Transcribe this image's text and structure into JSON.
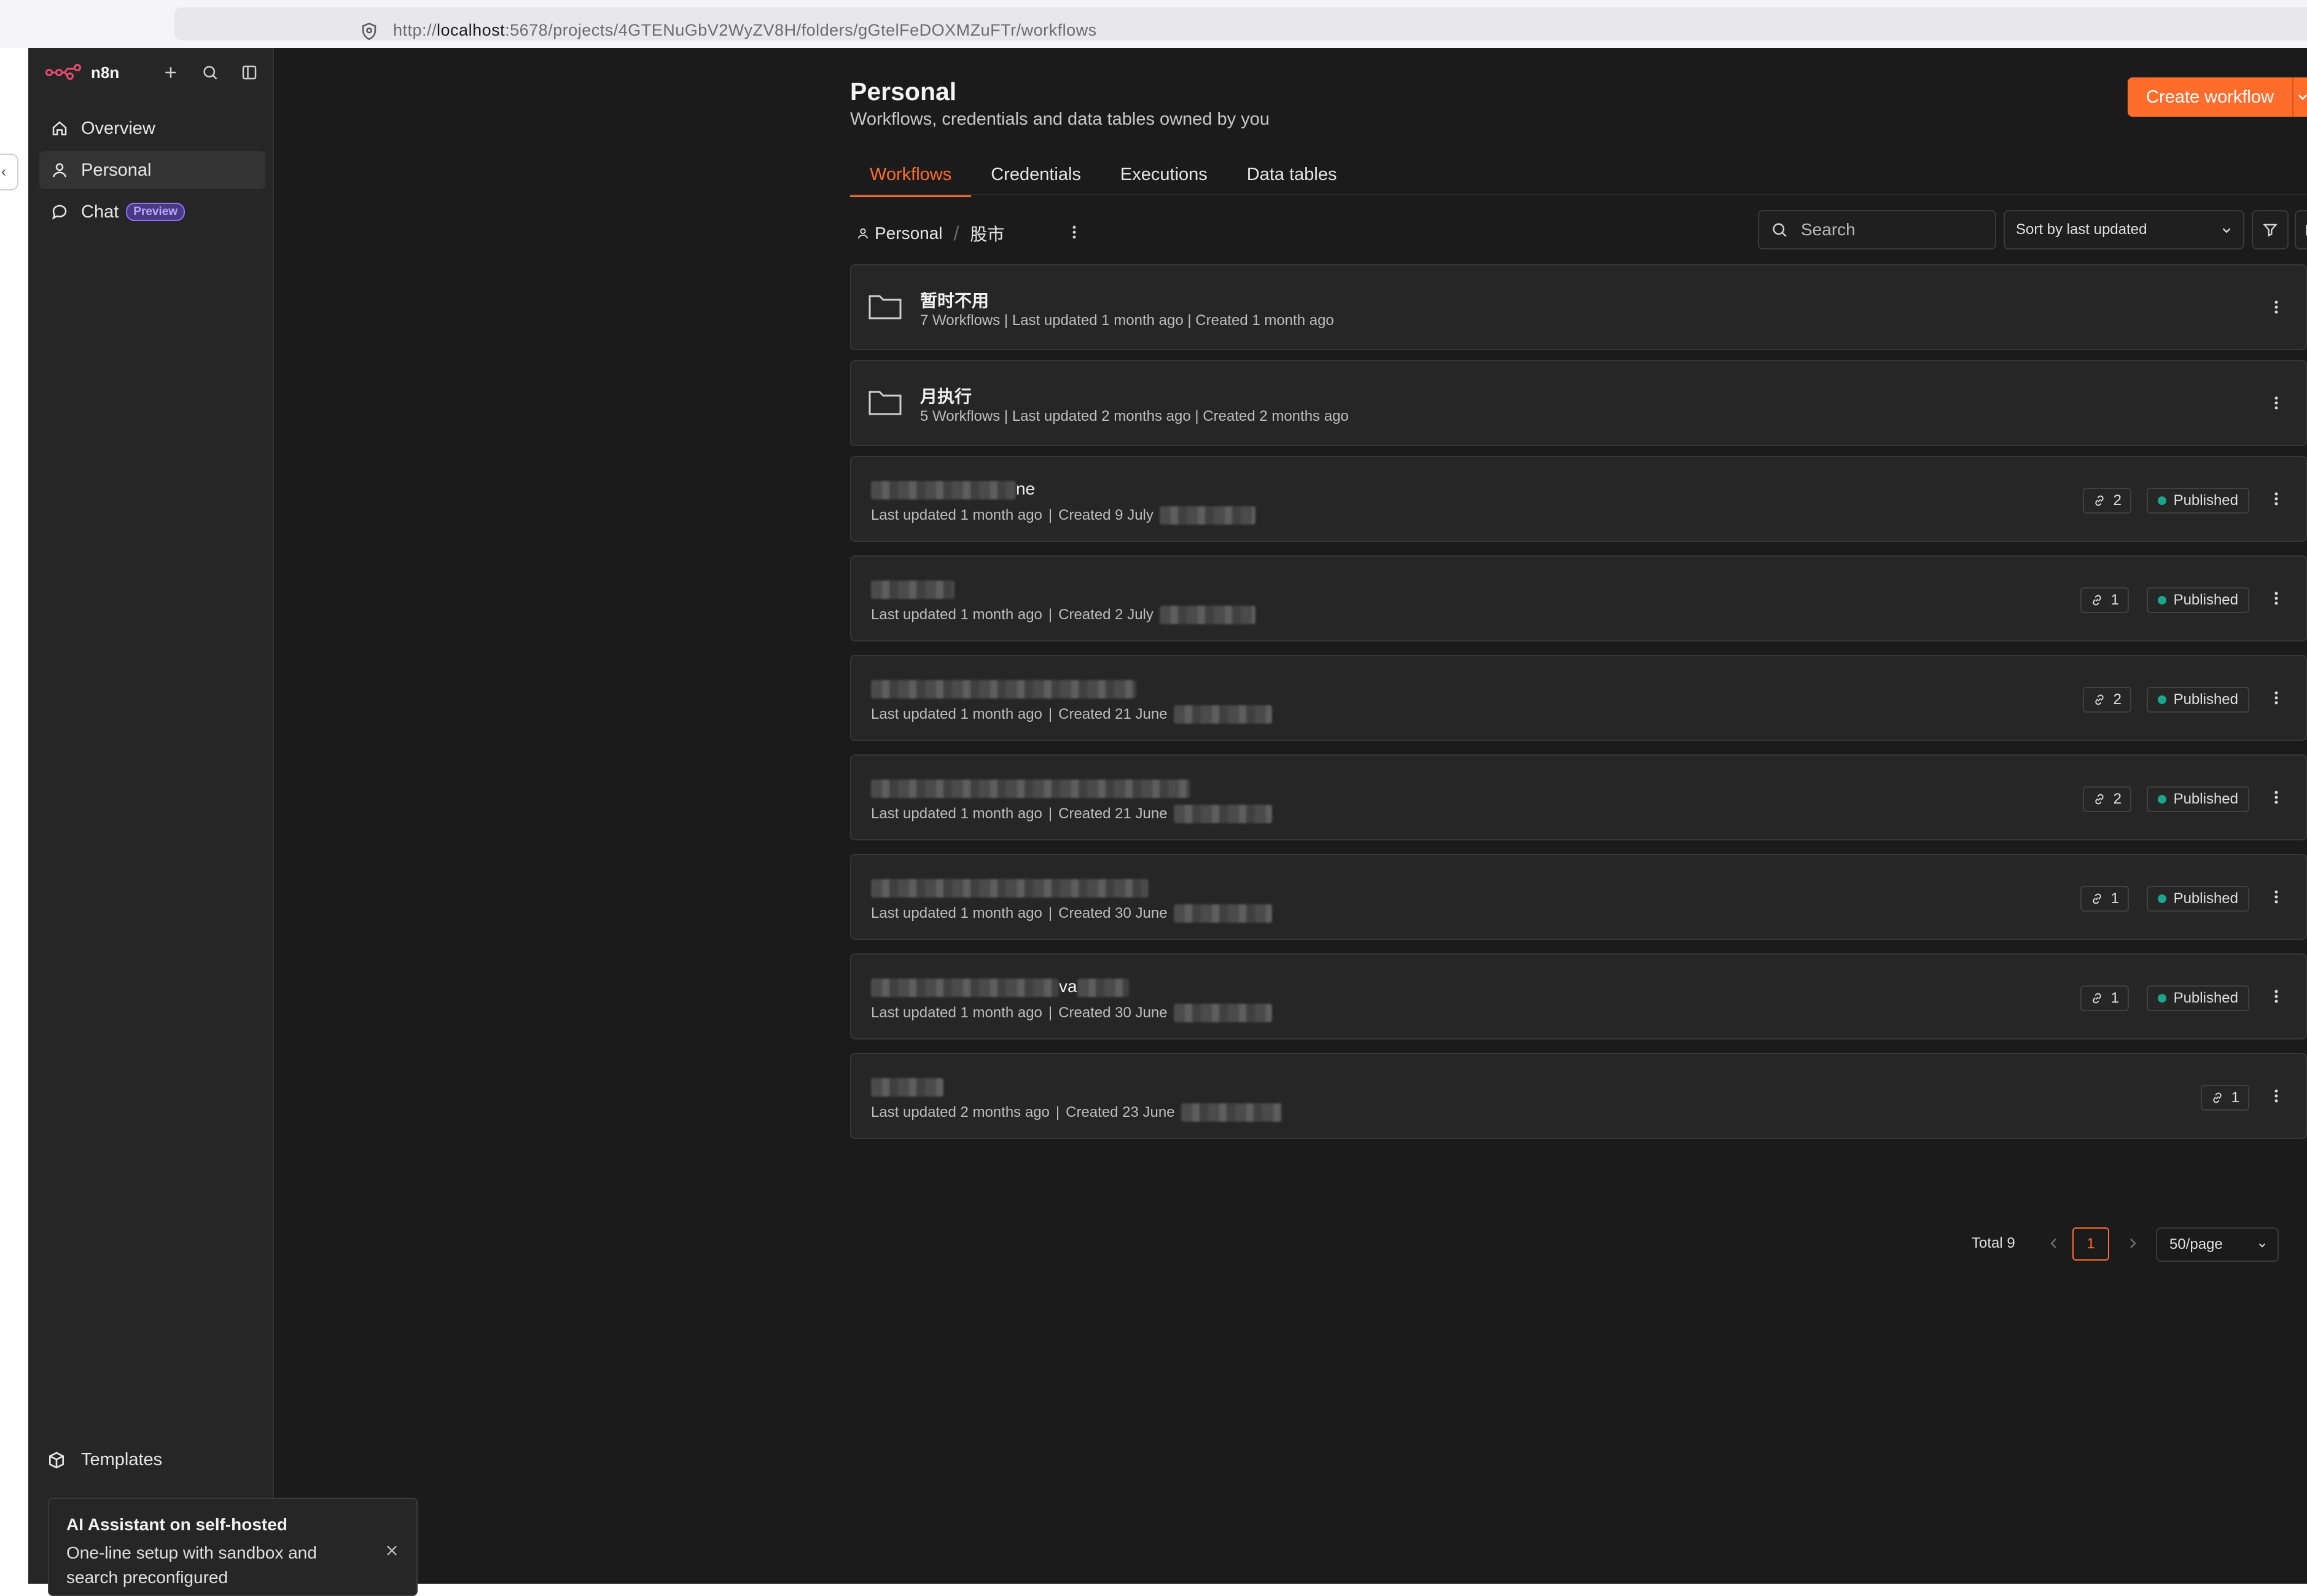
{
  "browser": {
    "url_prefix": "http://",
    "url_host": "localhost",
    "url_rest": ":5678/projects/4GTENuGbV2WyZV8H/folders/gGtelFeDOXMZuFTr/workflows"
  },
  "sidebar": {
    "brand": "n8n",
    "items": [
      {
        "label": "Overview",
        "icon": "home-icon"
      },
      {
        "label": "Personal",
        "icon": "user-icon",
        "active": true
      },
      {
        "label": "Chat",
        "icon": "chat-icon",
        "badge": "Preview"
      }
    ],
    "templates_label": "Templates"
  },
  "toast": {
    "title": "AI Assistant on self-hosted",
    "body": "One-line setup with sandbox and search preconfigured"
  },
  "header": {
    "title": "Personal",
    "subtitle": "Workflows, credentials and data tables owned by you",
    "create_label": "Create workflow"
  },
  "tabs": [
    {
      "label": "Workflows",
      "active": true
    },
    {
      "label": "Credentials"
    },
    {
      "label": "Executions"
    },
    {
      "label": "Data tables"
    }
  ],
  "breadcrumb": {
    "root": "Personal",
    "current": "股市"
  },
  "search": {
    "placeholder": "Search"
  },
  "sort": {
    "selected": "Sort by last updated"
  },
  "folders": [
    {
      "name": "暂时不用",
      "meta": "7 Workflows | Last updated 1 month ago | Created 1 month ago"
    },
    {
      "name": "月执行",
      "meta": "5 Workflows | Last updated 2 months ago | Created 2 months ago"
    }
  ],
  "workflows": [
    {
      "name_visible": "ne",
      "updated": "Last updated 1 month ago",
      "created": "Created 9 July",
      "links": "2",
      "status": "Published"
    },
    {
      "name_visible": "",
      "updated": "Last updated 1 month ago",
      "created": "Created 2 July",
      "links": "1",
      "status": "Published"
    },
    {
      "name_visible": "",
      "updated": "Last updated 1 month ago",
      "created": "Created 21 June",
      "links": "2",
      "status": "Published"
    },
    {
      "name_visible": "",
      "updated": "Last updated 1 month ago",
      "created": "Created 21 June",
      "links": "2",
      "status": "Published"
    },
    {
      "name_visible": "",
      "updated": "Last updated 1 month ago",
      "created": "Created 30 June",
      "links": "1",
      "status": "Published"
    },
    {
      "name_visible": "va",
      "updated": "Last updated 1 month ago",
      "created": "Created 30 June",
      "links": "1",
      "status": "Published"
    },
    {
      "name_visible": "",
      "updated": "Last updated 2 months ago",
      "created": "Created 23 June",
      "links": "1",
      "status": ""
    }
  ],
  "pagination": {
    "total": "Total 9",
    "current_page": "1",
    "page_size": "50/page"
  },
  "colors": {
    "accent": "#ff6d2d",
    "published": "#1aa68b",
    "preview": "#8c74ff",
    "background": "#1b1b1b"
  }
}
